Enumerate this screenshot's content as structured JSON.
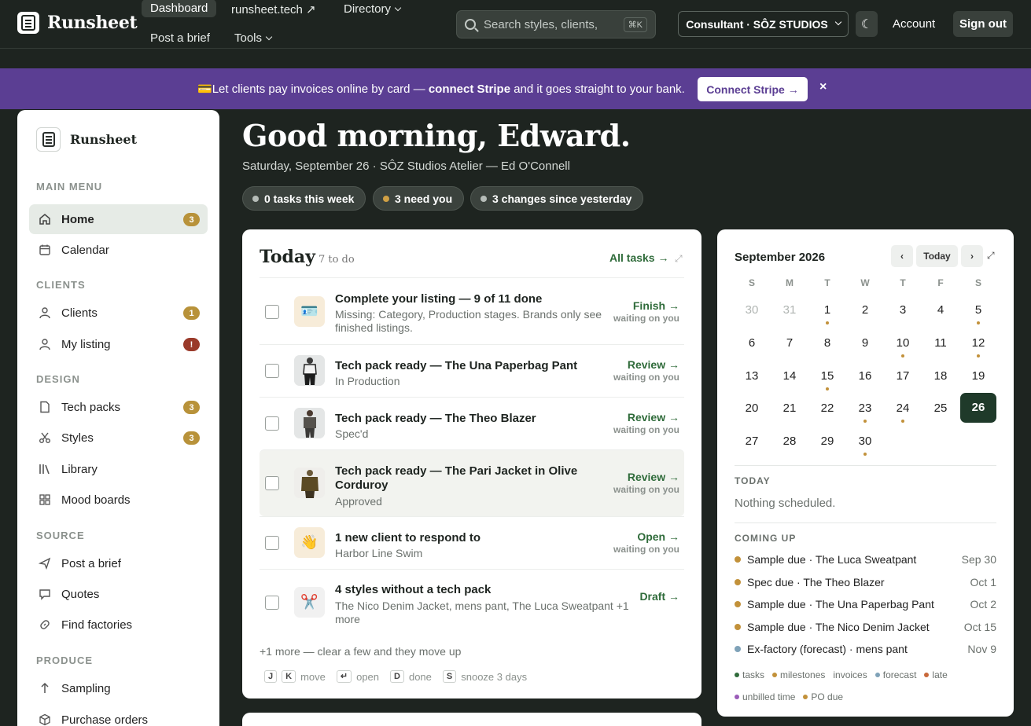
{
  "topnav": {
    "brand": "Runsheet",
    "links": [
      "Dashboard",
      "runsheet.tech ↗",
      "Directory",
      "Post a brief",
      "Tools"
    ],
    "search_placeholder": "Search styles, clients,",
    "search_shortcut": "⌘K",
    "consultant": "Consultant · SÔZ STUDIOS",
    "theme_icon": "☾",
    "account": "Account",
    "signout": "Sign out"
  },
  "banner": {
    "icon": "💳",
    "text_before": "Let clients pay invoices online by card — ",
    "text_bold": "connect Stripe",
    "text_after": " and it goes straight to your bank.",
    "button": "Connect Stripe →",
    "close": "×",
    "color": "#5b3e93"
  },
  "sidebar": {
    "brand": "Runsheet",
    "sections": [
      "MAIN MENU",
      "CLIENTS",
      "DESIGN",
      "SOURCE",
      "PRODUCE"
    ],
    "items": [
      {
        "label": "Home",
        "badge": "3",
        "icon": "home-icon"
      },
      {
        "label": "Calendar",
        "badge": "",
        "icon": "calendar-icon"
      },
      {
        "label": "Clients",
        "badge": "1",
        "icon": "user-icon"
      },
      {
        "label": "My listing",
        "badge": "!",
        "icon": "user-icon"
      },
      {
        "label": "Tech packs",
        "badge": "3",
        "icon": "document-icon"
      },
      {
        "label": "Styles",
        "badge": "3",
        "icon": "scissors-icon"
      },
      {
        "label": "Library",
        "badge": "",
        "icon": "library-icon"
      },
      {
        "label": "Mood boards",
        "badge": "",
        "icon": "grid-icon"
      },
      {
        "label": "Post a brief",
        "badge": "",
        "icon": "send-icon"
      },
      {
        "label": "Quotes",
        "badge": "",
        "icon": "quote-icon"
      },
      {
        "label": "Find factories",
        "badge": "",
        "icon": "link-icon"
      },
      {
        "label": "Sampling",
        "badge": "",
        "icon": "arrow-up-icon"
      },
      {
        "label": "Purchase orders",
        "badge": "",
        "icon": "box-icon"
      }
    ]
  },
  "header": {
    "greeting": "Good morning, Edward.",
    "subline": "Saturday, September 26 · SÔZ Studios Atelier — Ed O'Connell",
    "pills": [
      "0 tasks this week",
      "3 need you",
      "3 changes since yesterday"
    ]
  },
  "today": {
    "title": "Today",
    "count": "7 to do",
    "all_tasks": "All tasks →",
    "tasks": [
      {
        "title": "Complete your listing — 9 of 11 done",
        "sub": "Missing: Category, Production stages. Brands only see finished listings.",
        "action": "Finish →",
        "wait": "waiting on you",
        "thumb": "🪪"
      },
      {
        "title": "Tech pack ready — The Una Paperbag Pant",
        "sub": "In Production",
        "action": "Review →",
        "wait": "waiting on you",
        "thumb": ""
      },
      {
        "title": "Tech pack ready — The Theo Blazer",
        "sub": "Spec'd",
        "action": "Review →",
        "wait": "waiting on you",
        "thumb": ""
      },
      {
        "title": "Tech pack ready — The Pari Jacket in Olive Corduroy",
        "sub": "Approved",
        "action": "Review →",
        "wait": "waiting on you",
        "thumb": ""
      },
      {
        "title": "1 new client to respond to",
        "sub": "Harbor Line Swim",
        "action": "Open →",
        "wait": "waiting on you",
        "thumb": "👋"
      },
      {
        "title": "4 styles without a tech pack",
        "sub": "The Nico Denim Jacket, mens pant, The Luca Sweatpant +1 more",
        "action": "Draft →",
        "wait": "",
        "thumb": "✂️"
      }
    ],
    "more": "+1 more — clear a few and they move up",
    "shortcuts": [
      {
        "keys": [
          "J",
          "K"
        ],
        "label": "move"
      },
      {
        "keys": [
          "↵"
        ],
        "label": "open"
      },
      {
        "keys": [
          "D"
        ],
        "label": "done"
      },
      {
        "keys": [
          "S"
        ],
        "label": "snooze 3 days"
      }
    ]
  },
  "calendar": {
    "month": "September 2026",
    "prev": "‹",
    "today_btn": "Today",
    "next": "›",
    "expand": "⤢",
    "dow": [
      "S",
      "M",
      "T",
      "W",
      "T",
      "F",
      "S"
    ],
    "weeks": [
      [
        "30",
        "31",
        "1",
        "2",
        "3",
        "4",
        "5"
      ],
      [
        "6",
        "7",
        "8",
        "9",
        "10",
        "11",
        "12"
      ],
      [
        "13",
        "14",
        "15",
        "16",
        "17",
        "18",
        "19"
      ],
      [
        "20",
        "21",
        "22",
        "23",
        "24",
        "25",
        "26"
      ],
      [
        "27",
        "28",
        "29",
        "30",
        "",
        "",
        ""
      ]
    ],
    "marked_days": [
      "1",
      "5",
      "10",
      "12",
      "15",
      "23",
      "24",
      "30"
    ],
    "selected_day": "26",
    "today_label": "TODAY",
    "today_text": "Nothing scheduled.",
    "coming_label": "COMING UP",
    "coming": [
      {
        "label": "Sample due · The Luca Sweatpant",
        "date": "Sep 30",
        "color": "#c2913a"
      },
      {
        "label": "Spec due · The Theo Blazer",
        "date": "Oct 1",
        "color": "#c2913a"
      },
      {
        "label": "Sample due · The Una Paperbag Pant",
        "date": "Oct 2",
        "color": "#c2913a"
      },
      {
        "label": "Sample due · The Nico Denim Jacket",
        "date": "Oct 15",
        "color": "#c2913a"
      },
      {
        "label": "Ex-factory (forecast) · mens pant",
        "date": "Nov 9",
        "color": "#7fa2b8"
      }
    ],
    "legend": [
      {
        "label": "tasks",
        "color": "#2f6b3a"
      },
      {
        "label": "milestones",
        "color": "#c2913a"
      },
      {
        "label": "invoices",
        "color": ""
      },
      {
        "label": "forecast",
        "color": "#7fa2b8"
      },
      {
        "label": "late",
        "color": "#c8683a"
      },
      {
        "label": "unbilled time",
        "color": "#9a5bb8"
      },
      {
        "label": "PO due",
        "color": "#c2913a"
      }
    ]
  }
}
